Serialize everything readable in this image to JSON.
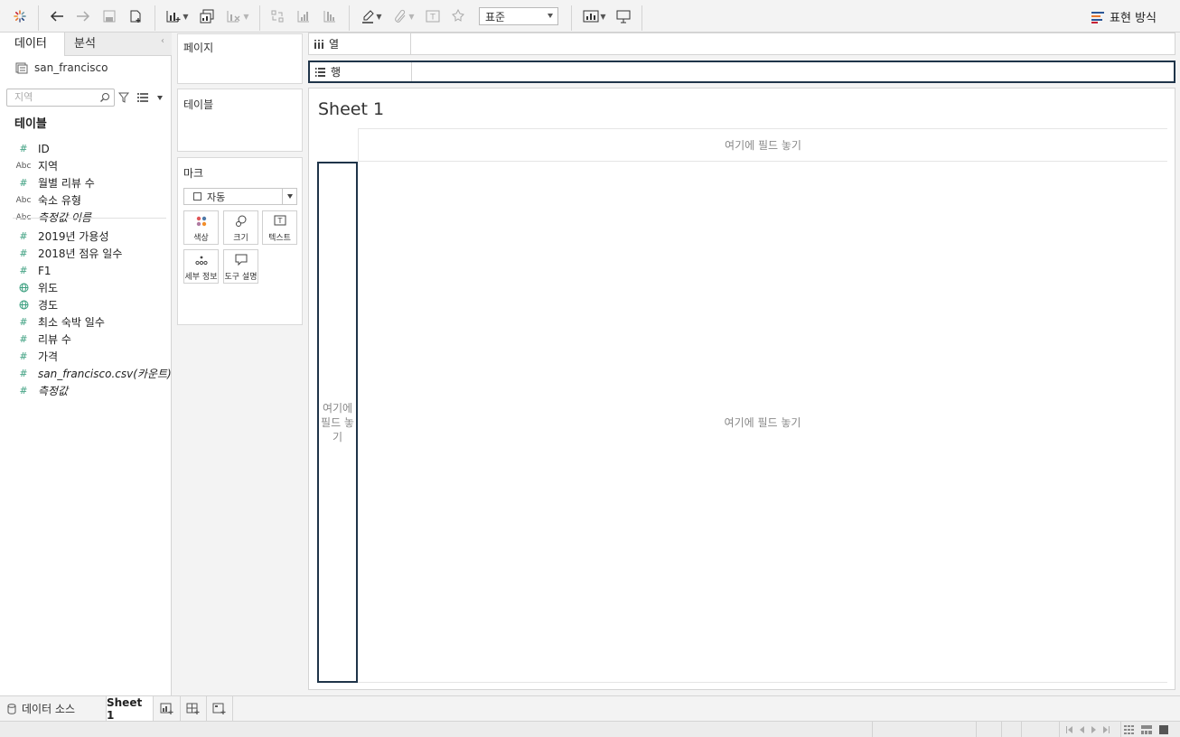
{
  "toolbar": {
    "standard_select": "표준",
    "show_me_label": "표현 방식"
  },
  "data_pane": {
    "tab_data": "데이터",
    "tab_analysis": "분석",
    "data_source": "san_francisco",
    "search_placeholder": "지역",
    "tables_heading": "테이블",
    "fields": [
      {
        "type": "number",
        "name": "ID"
      },
      {
        "type": "string",
        "name": "지역"
      },
      {
        "type": "number",
        "name": "월별 리뷰 수"
      },
      {
        "type": "string",
        "name": "숙소 유형"
      },
      {
        "type": "string",
        "name": "측정값 이름"
      },
      {
        "type": "number",
        "name": "2019년 가용성"
      },
      {
        "type": "number",
        "name": "2018년 점유 일수"
      },
      {
        "type": "number",
        "name": "F1"
      },
      {
        "type": "geo",
        "name": "위도"
      },
      {
        "type": "geo",
        "name": "경도"
      },
      {
        "type": "number",
        "name": "최소 숙박 일수"
      },
      {
        "type": "number",
        "name": "리뷰 수"
      },
      {
        "type": "number",
        "name": "가격"
      },
      {
        "type": "number",
        "name": "san_francisco.csv(카운트)"
      },
      {
        "type": "number",
        "name": "측정값"
      }
    ],
    "icon_text": {
      "string": "Abc",
      "number": "#"
    }
  },
  "cards": {
    "pages": "페이지",
    "filters": "테이블",
    "marks": "마크",
    "mark_type": "자동",
    "mark_buttons": {
      "color": "색상",
      "size": "크기",
      "text": "텍스트",
      "detail": "세부 정보",
      "tooltip": "도구 설명"
    }
  },
  "shelves": {
    "columns": "열",
    "rows": "행"
  },
  "sheet": {
    "title": "Sheet 1",
    "drop_col": "여기에 필드 놓기",
    "drop_row": "여기에 필드 놓기",
    "drop_body": "여기에 필드 놓기"
  },
  "bottom": {
    "data_source_tab": "데이터 소스",
    "sheet_tab": "Sheet 1"
  },
  "colors": {
    "accent_dark": "#1f3449",
    "measure_green": "#3a9e7e"
  }
}
